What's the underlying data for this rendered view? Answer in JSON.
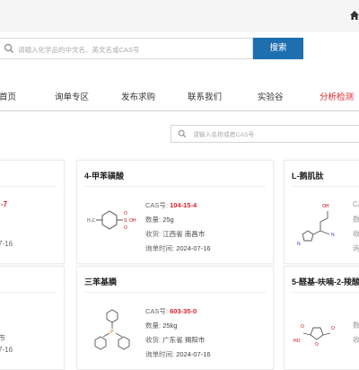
{
  "header": {
    "home_icon": "home-icon"
  },
  "search": {
    "placeholder": "请输入化学品的中文名、英文名或CAS号",
    "button_label": "搜索"
  },
  "nav": {
    "items": [
      {
        "label": "首页"
      },
      {
        "label": "询单专区"
      },
      {
        "label": "发布求购"
      },
      {
        "label": "联系我们"
      },
      {
        "label": "实验谷"
      },
      {
        "label": "分析检测"
      }
    ],
    "active_index": 5,
    "active_color": "#e0212a"
  },
  "filter": {
    "placeholder": "请输入名称或者CAS号"
  },
  "labels": {
    "cas": "CAS号:",
    "qty": "数量:",
    "location": "收货:",
    "time": "询单时间:"
  },
  "cards": [
    {
      "title": "4-甲苯磺酸",
      "cas": "104-15-4",
      "qty": "25g",
      "location": "江西省 南昌市",
      "time": "2024-07-16"
    },
    {
      "title": "L-鹅肌肽"
    },
    {
      "title": "三苯基膦",
      "cas": "603-35-0",
      "qty": "25kg",
      "location": "广东省 揭阳市",
      "time": "2024-07-16"
    },
    {
      "title": "5-醛基-呋喃-2-羧酸"
    }
  ],
  "left_fragments": {
    "top": {
      "cas_tail": "-7",
      "time_tail": "7-16"
    },
    "bottom": {
      "loc_tail": "市",
      "time_tail": "7-16"
    }
  },
  "right_fragments": {
    "c1": "CA",
    "qty": "数",
    "loc": "收",
    "time": "询"
  },
  "colors": {
    "brand_blue": "#1e6fb0",
    "accent_red": "#e0212a"
  }
}
